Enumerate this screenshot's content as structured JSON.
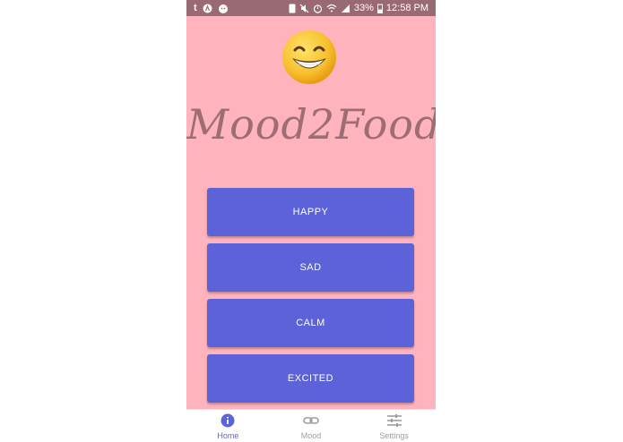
{
  "status_bar": {
    "left_icons": [
      "tumblr-icon",
      "app-icon",
      "cat-icon"
    ],
    "battery": "33%",
    "time": "12:58 PM"
  },
  "app": {
    "title": "Mood2Food",
    "emoji": "😁"
  },
  "moods": [
    {
      "label": "HAPPY"
    },
    {
      "label": "SAD"
    },
    {
      "label": "CALM"
    },
    {
      "label": "EXCITED"
    }
  ],
  "nav": {
    "items": [
      {
        "label": "Home",
        "icon": "info-icon",
        "active": true
      },
      {
        "label": "Mood",
        "icon": "link-icon",
        "active": false
      },
      {
        "label": "Settings",
        "icon": "sliders-icon",
        "active": false
      }
    ]
  },
  "colors": {
    "background": "#ffb3bd",
    "status_bar": "#9a6a74",
    "button": "#5c63d8",
    "title": "#9c6d72"
  }
}
